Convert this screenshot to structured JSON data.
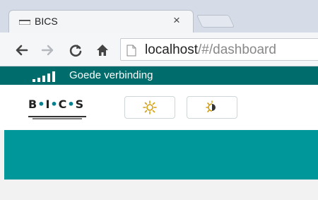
{
  "browser": {
    "tab": {
      "title": "BICS",
      "close_label": "×",
      "favicon": "window-favicon-icon"
    },
    "toolbar": {
      "back_icon": "back-arrow-icon",
      "forward_icon": "forward-arrow-icon",
      "reload_icon": "reload-icon",
      "home_icon": "home-icon",
      "url_host": "localhost",
      "url_path": "/#/dashboard"
    }
  },
  "app": {
    "connection": {
      "status_text": "Goede verbinding",
      "icon": "signal-strength-icon"
    },
    "logo": {
      "text_b": "B",
      "text_i": "I",
      "text_c": "C",
      "text_s": "S"
    },
    "header_buttons": [
      {
        "icon": "sun-brightness-icon"
      },
      {
        "icon": "day-night-toggle-icon"
      }
    ],
    "colors": {
      "dark_teal": "#006d6c",
      "teal": "#00979a"
    }
  }
}
